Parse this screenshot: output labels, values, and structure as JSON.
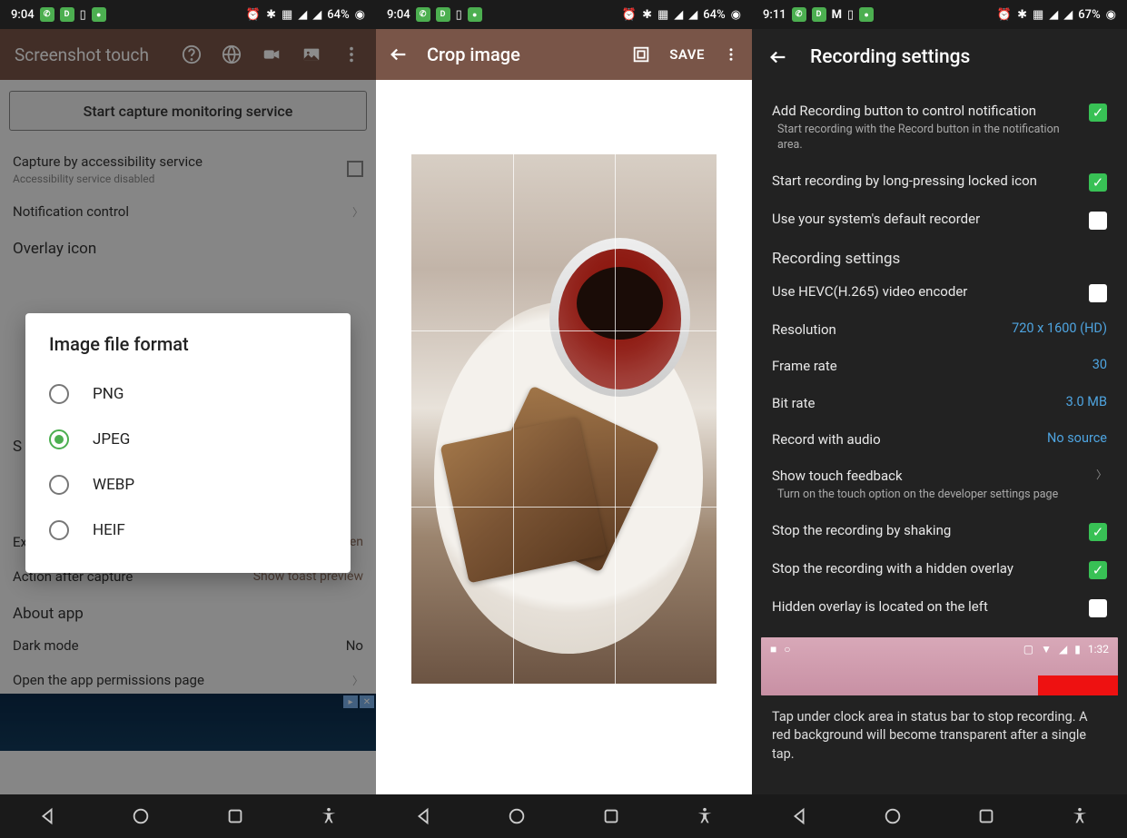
{
  "phone1": {
    "status": {
      "time": "9:04",
      "battery": "64%"
    },
    "toolbar": {
      "title": "Screenshot touch"
    },
    "start_btn": "Start capture monitoring service",
    "capture_acc": {
      "label": "Capture by accessibility service",
      "sub": "Accessibility service disabled"
    },
    "notif_control": "Notification control",
    "overlay_hdr": "Overlay icon",
    "save_hdr": "S",
    "exclude_sb": {
      "label": "Exclude status bar",
      "value": "Fullscreen"
    },
    "action_after": {
      "label": "Action after capture",
      "value": "Show toast preview"
    },
    "about_hdr": "About app",
    "dark_mode": {
      "label": "Dark mode",
      "value": "No"
    },
    "perms": "Open the app permissions page",
    "dialog": {
      "title": "Image file format",
      "options": [
        "PNG",
        "JPEG",
        "WEBP",
        "HEIF"
      ],
      "selected": 1
    }
  },
  "phone2": {
    "status": {
      "time": "9:04",
      "battery": "64%"
    },
    "toolbar": {
      "title": "Crop image",
      "save": "SAVE"
    }
  },
  "phone3": {
    "status": {
      "time": "9:11",
      "battery": "67%"
    },
    "toolbar": {
      "title": "Recording settings"
    },
    "rows": {
      "add_btn": {
        "label": "Add Recording button to control notification",
        "sub": "Start recording with the Record button in the notification area.",
        "checked": true
      },
      "longpress": {
        "label": "Start recording by long-pressing locked icon",
        "checked": true
      },
      "default_rec": {
        "label": "Use your system's default recorder",
        "checked": false
      },
      "section": "Recording settings",
      "hevc": {
        "label": "Use HEVC(H.265) video encoder",
        "checked": false
      },
      "resolution": {
        "label": "Resolution",
        "value": "720 x 1600 (HD)"
      },
      "framerate": {
        "label": "Frame rate",
        "value": "30"
      },
      "bitrate": {
        "label": "Bit rate",
        "value": "3.0 MB"
      },
      "audio": {
        "label": "Record with audio",
        "value": "No source"
      },
      "touch": {
        "label": "Show touch feedback",
        "sub": "Turn on the touch option on the developer settings page"
      },
      "shake": {
        "label": "Stop the recording by shaking",
        "checked": true
      },
      "hidden": {
        "label": "Stop the recording with a hidden overlay",
        "checked": true
      },
      "hidden_left": {
        "label": "Hidden overlay is located on the left",
        "checked": false
      }
    },
    "demo_time": "1:32",
    "hint": "Tap under clock area in status bar to stop recording. A red background will become transparent after a single tap."
  }
}
